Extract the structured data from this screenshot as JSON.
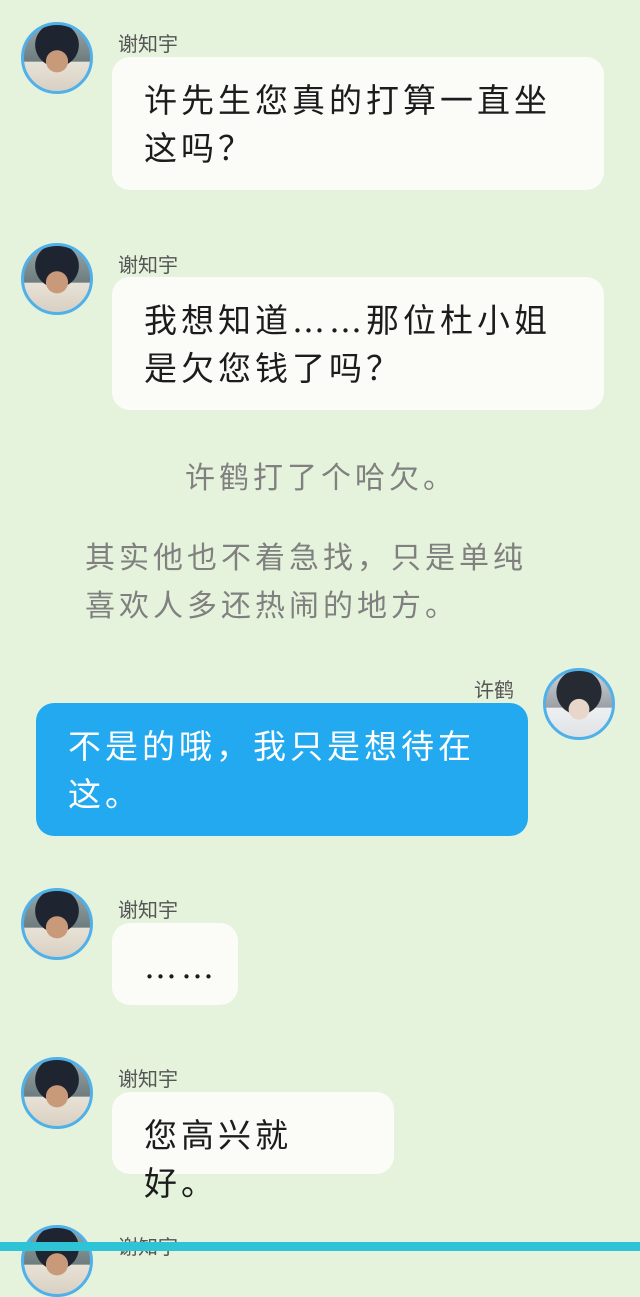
{
  "messages": [
    {
      "sender": "谢知宇",
      "text": "许先生您真的打算一直坐这吗？"
    },
    {
      "sender": "谢知宇",
      "text": "我想知道……那位杜小姐是欠您钱了吗？"
    },
    {
      "sender": "许鹤",
      "text": "不是的哦，我只是想待在这。"
    },
    {
      "sender": "谢知宇",
      "text": "……"
    },
    {
      "sender": "谢知宇",
      "text": "您高兴就好。"
    },
    {
      "sender": "谢知宇"
    }
  ],
  "narration": [
    "许鹤打了个哈欠。",
    "其实他也不着急找，只是单纯喜欢人多还热闹的地方。"
  ],
  "colors": {
    "accent": "#22a9ef",
    "background": "#e6f3dc",
    "avatar_ring": "#4fb0ea"
  }
}
